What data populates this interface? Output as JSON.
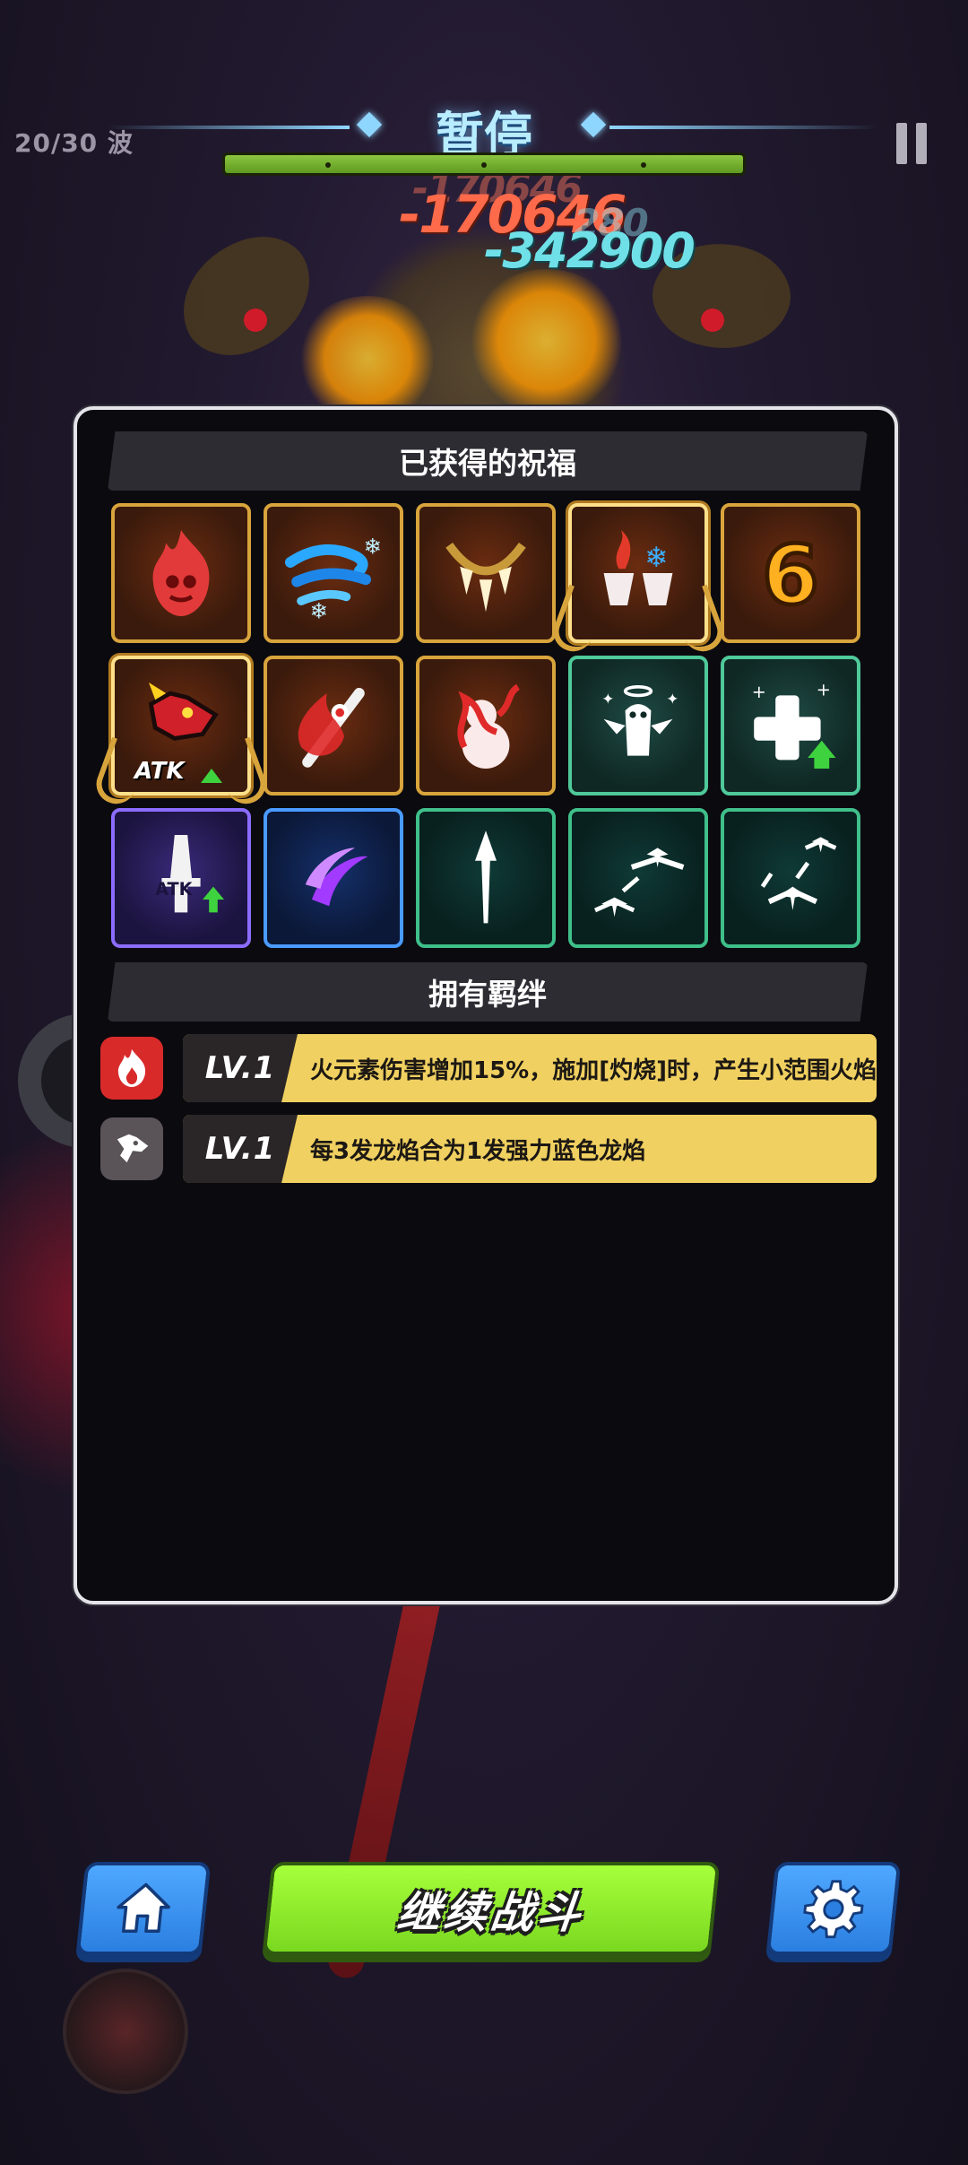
{
  "hud": {
    "wave": "20/30 波",
    "title": "暂停",
    "boss_hp_fraction": 1.0
  },
  "damage_numbers": [
    "-170646",
    "-170646",
    "-342900",
    "280"
  ],
  "blessings": {
    "header": "已获得的祝福",
    "items": [
      {
        "icon": "fire-spirit-icon",
        "frame": "gold"
      },
      {
        "icon": "frost-wind-icon",
        "frame": "gold"
      },
      {
        "icon": "fang-necklace-icon",
        "frame": "gold"
      },
      {
        "icon": "fire-ice-cups-icon",
        "frame": "gold-special"
      },
      {
        "icon": "number-six-icon",
        "frame": "gold",
        "label": "6"
      },
      {
        "icon": "dragon-atk-up-icon",
        "frame": "gold-special",
        "label": "ATK"
      },
      {
        "icon": "flame-sword-icon",
        "frame": "gold"
      },
      {
        "icon": "fire-gourd-icon",
        "frame": "gold"
      },
      {
        "icon": "angel-spirit-icon",
        "frame": "green"
      },
      {
        "icon": "heal-plus-icon",
        "frame": "green"
      },
      {
        "icon": "dagger-atk-up-icon",
        "frame": "purple",
        "label": "ATK"
      },
      {
        "icon": "purple-slash-icon",
        "frame": "blue"
      },
      {
        "icon": "arrow-up-icon",
        "frame": "teal"
      },
      {
        "icon": "birds-split-icon",
        "frame": "teal"
      },
      {
        "icon": "birds-multiply-icon",
        "frame": "teal"
      }
    ]
  },
  "bonds": {
    "header": "拥有羁绊",
    "items": [
      {
        "icon": "fire-bond-icon",
        "level": "LV.1",
        "text": "火元素伤害增加15%，施加[灼烧]时，产生小范围火焰"
      },
      {
        "icon": "dragon-bond-icon",
        "level": "LV.1",
        "text": "每3发龙焰合为1发强力蓝色龙焰"
      }
    ]
  },
  "buttons": {
    "home": "home-icon",
    "continue": "继续战斗",
    "settings": "gear-icon"
  },
  "colors": {
    "gold_frame": "#d8a43c",
    "green_frame": "#4fc99a",
    "purple_frame": "#8c6cff",
    "blue_frame": "#4a9bff",
    "bond_bar": "#f0d060",
    "continue_button": "#8fe82a",
    "side_buttons": "#3a94f5"
  }
}
